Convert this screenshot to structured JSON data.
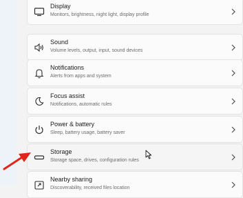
{
  "settings": {
    "items": [
      {
        "title": "Display",
        "subtitle": "Monitors, brightness, night light, display profile",
        "icon": "display-icon"
      },
      {
        "title": "Sound",
        "subtitle": "Volume levels, output, input, sound devices",
        "icon": "speaker-icon"
      },
      {
        "title": "Notifications",
        "subtitle": "Alerts from apps and system",
        "icon": "bell-icon"
      },
      {
        "title": "Focus assist",
        "subtitle": "Notifications, automatic rules",
        "icon": "moon-icon"
      },
      {
        "title": "Power & battery",
        "subtitle": "Sleep, battery usage, battery saver",
        "icon": "power-icon"
      },
      {
        "title": "Storage",
        "subtitle": "Storage space, drives, configuration rules",
        "icon": "storage-drive-icon"
      },
      {
        "title": "Nearby sharing",
        "subtitle": "Discoverability, received files location",
        "icon": "share-icon"
      }
    ]
  },
  "annotation": {
    "arrow_color": "#e0261b",
    "pointer": "mouse-cursor-icon"
  },
  "colors": {
    "page_background": "#f3f3f3",
    "card_background": "#fbfbfb",
    "title_text": "#1b1b1b",
    "subtitle_text": "#6b6b6b"
  }
}
